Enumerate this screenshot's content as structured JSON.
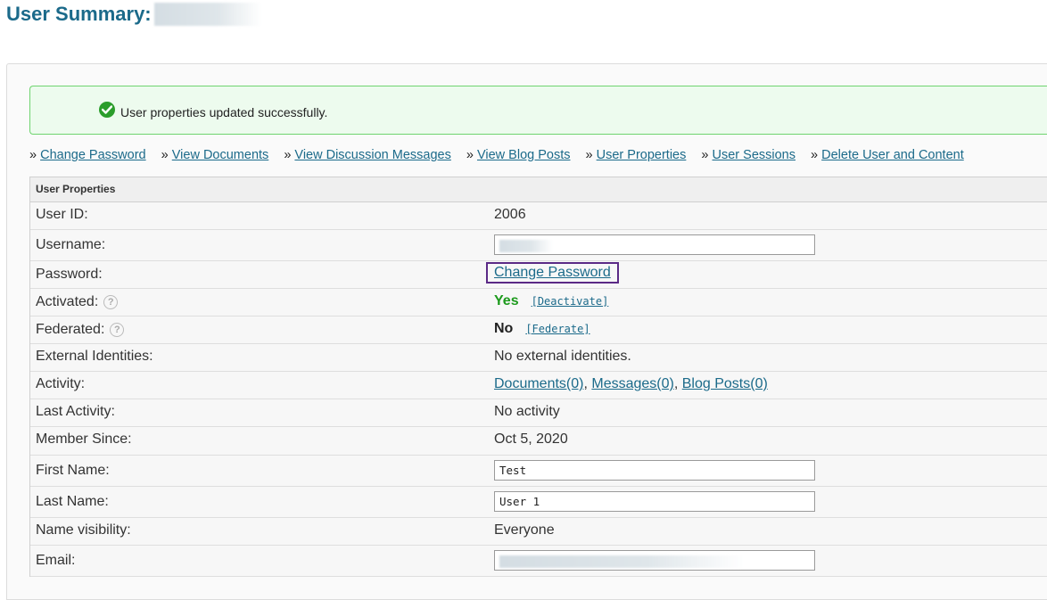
{
  "page": {
    "title": "User Summary:"
  },
  "alert": {
    "message": "User properties updated successfully.",
    "icon": "check-circle-icon",
    "color": "#2b9d2b"
  },
  "nav_links": [
    {
      "prefix": "»",
      "label": "Change Password"
    },
    {
      "prefix": "»",
      "label": "View Documents"
    },
    {
      "prefix": "»",
      "label": "View Discussion Messages"
    },
    {
      "prefix": "»",
      "label": "View Blog Posts"
    },
    {
      "prefix": "»",
      "label": "User Properties"
    },
    {
      "prefix": "»",
      "label": "User Sessions"
    },
    {
      "prefix": "»",
      "label": "Delete User and Content"
    }
  ],
  "properties": {
    "header": "User Properties",
    "user_id": {
      "label": "User ID:",
      "value": "2006"
    },
    "username": {
      "label": "Username:"
    },
    "password": {
      "label": "Password:",
      "link": "Change Password"
    },
    "activated": {
      "label": "Activated:",
      "value": "Yes",
      "action": "[Deactivate]"
    },
    "federated": {
      "label": "Federated:",
      "value": "No",
      "action": "[Federate]"
    },
    "external_identities": {
      "label": "External Identities:",
      "value": "No external identities."
    },
    "activity": {
      "label": "Activity:",
      "documents": "Documents(0)",
      "messages": "Messages(0)",
      "blog_posts": "Blog Posts(0)"
    },
    "last_activity": {
      "label": "Last Activity:",
      "value": "No activity"
    },
    "member_since": {
      "label": "Member Since:",
      "value": "Oct 5, 2020"
    },
    "first_name": {
      "label": "First Name:",
      "value": "Test"
    },
    "last_name": {
      "label": "Last Name:",
      "value": "User 1"
    },
    "name_visibility": {
      "label": "Name visibility:",
      "value": "Everyone"
    },
    "email": {
      "label": "Email:"
    }
  },
  "colors": {
    "title": "#1b6a8a",
    "link": "#1b6a8a",
    "success_border": "#6fd46f",
    "success_bg": "#edfbee",
    "activated_yes": "#1c9a1c",
    "highlight_box": "#5b2a86"
  }
}
